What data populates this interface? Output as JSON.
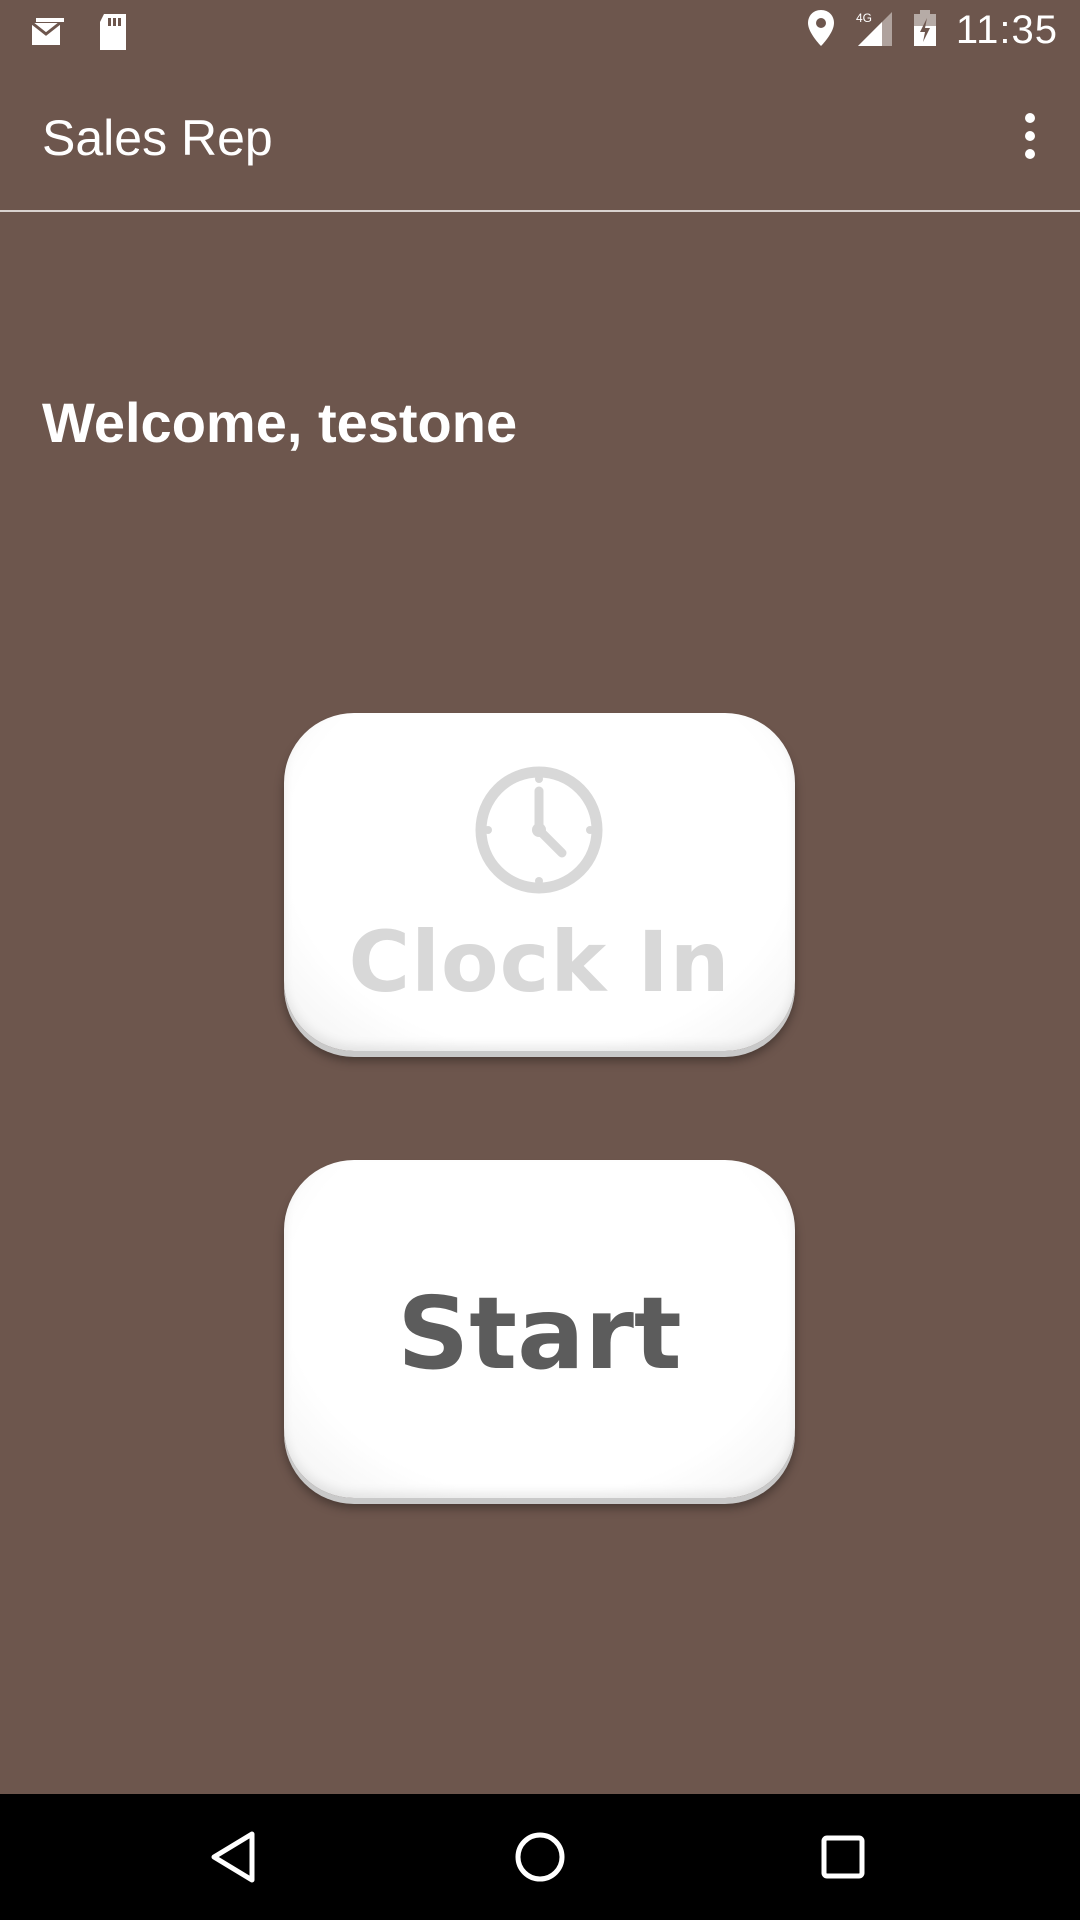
{
  "status_bar": {
    "time": "11:35",
    "network": "4G",
    "icons": [
      "message-notification-icon",
      "sd-card-icon",
      "location-icon",
      "cellular-signal-icon",
      "battery-charging-icon"
    ]
  },
  "app_bar": {
    "title": "Sales Rep",
    "menu_icon": "overflow-menu-icon"
  },
  "main": {
    "welcome_text": "Welcome, testone",
    "clock_in_label": "Clock In",
    "start_label": "Start"
  },
  "nav_bar": {
    "icons": [
      "back-icon",
      "home-icon",
      "recents-icon"
    ]
  },
  "colors": {
    "background": "#6d564d",
    "button_face": "#ffffff",
    "clock_in_text": "#d8d8d8",
    "start_text": "#5c5c5c",
    "nav_bar": "#000000"
  }
}
